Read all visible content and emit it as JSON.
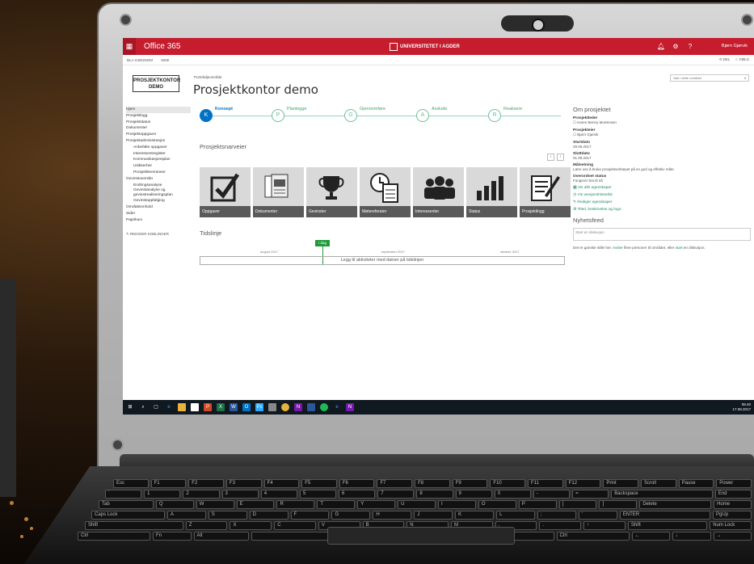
{
  "suitebar": {
    "app_name": "Office 365",
    "org_name": "UNIVERSITETET I AGDER",
    "user_name": "Bjørn Gjørvik",
    "icons": [
      "app-launcher-icon",
      "bell-icon",
      "gear-icon",
      "help-icon"
    ]
  },
  "ribbon": {
    "browse": "BLA GJENNOM",
    "page": "SIDE",
    "share": "DEL",
    "follow": "FØLG"
  },
  "site": {
    "logo_line1": "PROSJEKTKONTOR",
    "logo_line2": "DEMO",
    "breadcrumb": "Porteføljeområde",
    "title": "Prosjektkontor demo",
    "search_placeholder": "Søk i dette området"
  },
  "nav": {
    "items": [
      "Hjem",
      "Prosjektlogg",
      "Prosjektstatus",
      "Dokumenter",
      "Prosjektoppgaver",
      "Prosjektadministrasjon",
      "Anbefalte oppgaver",
      "Interessentregister",
      "Kommunikasjonsplan",
      "Usikkerhet",
      "Prosjektleveranser",
      "Gevinstoversikt",
      "Endringsanalyse",
      "Gevinstanalyse og gevinstrealiseringsplan",
      "Gevinstoppfølging",
      "Områdeinnhold",
      "Sider",
      "Papirkurv"
    ],
    "edit_links": "REDIGER KOBLINGER"
  },
  "phases": [
    {
      "letter": "K",
      "name": "Konsept",
      "active": true
    },
    {
      "letter": "P",
      "name": "Planlegge",
      "active": false
    },
    {
      "letter": "G",
      "name": "Gjennomføre",
      "active": false
    },
    {
      "letter": "A",
      "name": "Avslutte",
      "active": false
    },
    {
      "letter": "R",
      "name": "Realisere",
      "active": false
    }
  ],
  "shortcuts": {
    "heading": "Prosjektsnarveier",
    "prev": "‹",
    "next": "›",
    "tiles": [
      {
        "label": "Oppgaver",
        "icon": "checkbox-icon"
      },
      {
        "label": "Dokumenter",
        "icon": "documents-icon"
      },
      {
        "label": "Gevinster",
        "icon": "trophy-icon"
      },
      {
        "label": "Møtereferater",
        "icon": "clock-clipboard-icon"
      },
      {
        "label": "Interessenter",
        "icon": "people-icon"
      },
      {
        "label": "Status",
        "icon": "bar-chart-icon"
      },
      {
        "label": "Prosjektlogg",
        "icon": "notepad-pen-icon"
      }
    ]
  },
  "timeline": {
    "heading": "Tidslinje",
    "today": "I dag",
    "months": [
      "august 2017",
      "september 2017",
      "oktober 2017"
    ],
    "placeholder": "Legg til aktiviteter med datoer på tidslinjen"
  },
  "about": {
    "heading": "Om prosjektet",
    "fields": [
      {
        "label": "Prosjektleder",
        "value": "Karen Benny Mortensen"
      },
      {
        "label": "Prosjekteier",
        "value": "Bjørn Gjørvik"
      },
      {
        "label": "Startdato",
        "value": "29.06.2017"
      },
      {
        "label": "Sluttdato",
        "value": "01.09.2017"
      },
      {
        "label": "Målsetning",
        "value": "Lære oss å bruke prosjektverktøyet på en god og effektiv måte"
      },
      {
        "label": "Overordnet status",
        "value": "Fungerer bra til nå"
      }
    ],
    "links": [
      "Vis alle egenskaper",
      "Vis versjonshistorikk",
      "Rediger egenskaper",
      "Tittel, beskrivelse og logo"
    ]
  },
  "newsfeed": {
    "heading": "Nyhetsfeed",
    "input_placeholder": "Start en diskusjon",
    "text_before": "Det er ganske stille her. ",
    "invite_link": "Inviter",
    "text_middle": " flere personer til området, eller ",
    "start_link": "start",
    "text_after": " en diskusjon."
  },
  "taskbar": {
    "time": "08.40",
    "date": "17.08.2017"
  },
  "colors": {
    "suitebar": "#c51c2e",
    "phase_active": "#0072c6",
    "phase_done": "#3fa66c",
    "tile_label": "#5a5a5a",
    "link": "#1f8a6a"
  }
}
